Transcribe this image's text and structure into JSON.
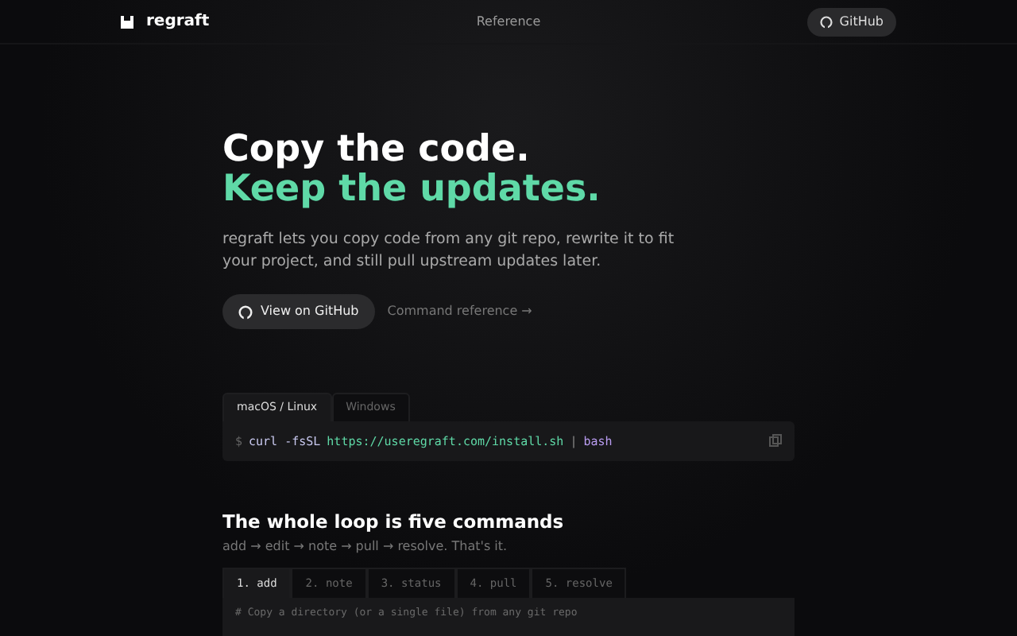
{
  "navbar": {
    "brand": "regraft",
    "link": "Reference",
    "github": "GitHub"
  },
  "hero": {
    "title": "Copy the code.",
    "accent": "Keep the updates.",
    "text": "regraft lets you copy code from any git repo, rewrite it to fit your project, and still pull upstream updates later.",
    "primary": "View on GitHub",
    "secondary": "Command reference →"
  },
  "install": {
    "tabs": [
      {
        "label": "macOS / Linux",
        "selected": true
      },
      {
        "label": "Windows",
        "selected": false
      }
    ],
    "tokens": [
      {
        "kind": "prompt",
        "text": "$"
      },
      {
        "kind": "cmd",
        "text": "curl -fsSL"
      },
      {
        "kind": "url",
        "text": "https://useregraft.com/install.sh"
      },
      {
        "kind": "pipe",
        "text": "|"
      },
      {
        "kind": "keyword",
        "text": "bash"
      }
    ]
  },
  "loop": {
    "title": "The whole loop is five commands",
    "subtitle": "add → edit → note → pull → resolve. That's it.",
    "tabs": [
      {
        "label": "1. add",
        "selected": true
      },
      {
        "label": "2. note",
        "selected": false
      },
      {
        "label": "3. status",
        "selected": false
      },
      {
        "label": "4. pull",
        "selected": false
      },
      {
        "label": "5. resolve",
        "selected": false
      }
    ],
    "comment": "# Copy a directory (or a single file) from any git repo"
  }
}
